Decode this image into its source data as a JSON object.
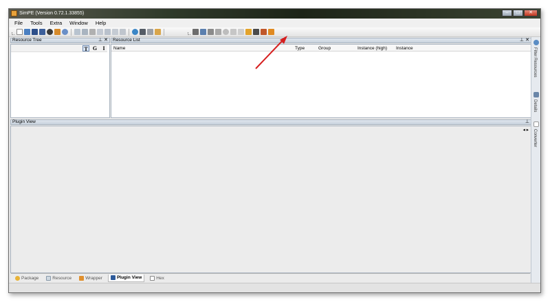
{
  "window": {
    "title": "SimPE (Version 0.72.1.33855)",
    "controls": {
      "minimize": "–",
      "maximize": "□",
      "close": "✕"
    }
  },
  "menu": [
    "File",
    "Tools",
    "Extra",
    "Window",
    "Help"
  ],
  "toolbar": {
    "groups": [
      {
        "icons": [
          "new-file-icon",
          "open-file-icon",
          "save-icon",
          "save-as-icon",
          "globe-icon",
          "tools-icon",
          "gear-icon"
        ]
      },
      {
        "icons": [
          "copy-icon",
          "paste-icon",
          "cut-icon",
          "find-icon",
          "find-next-icon",
          "list-icon",
          "grid-icon"
        ]
      },
      {
        "icons": [
          "refresh-icon",
          "user-icon",
          "wrench-icon",
          "tag-icon"
        ]
      },
      {
        "icons": [
          "package-icon",
          "open-package-icon",
          "folder-icon",
          "merge-icon",
          "gear-small-icon",
          "list-small-icon",
          "cross-icon",
          "lock-icon",
          "camera-icon",
          "scissors-icon",
          "fire-icon"
        ]
      }
    ],
    "highlight_arrow_color": "#d61f1f"
  },
  "resource_tree": {
    "title": "Resource Tree",
    "pin": "⊥",
    "close": "✕",
    "view_buttons": [
      "T",
      "G",
      "I"
    ],
    "active_view": "T"
  },
  "resource_list": {
    "title": "Resource List",
    "pin": "⊥",
    "close": "✕",
    "columns": [
      "Name",
      "Type",
      "Group",
      "Instance (high)",
      "Instance"
    ],
    "rows": []
  },
  "plugin_view": {
    "title": "Plugin View",
    "pin": "⊥",
    "nav": "◂ ▸"
  },
  "side_tabs": [
    {
      "label": "Filter Resources",
      "icon": "magnifier-icon"
    },
    {
      "label": "Details",
      "icon": "details-icon"
    },
    {
      "label": "Converter",
      "icon": "converter-icon"
    }
  ],
  "bottom_tabs": [
    {
      "label": "Package",
      "icon": "package-tab-icon",
      "active": false
    },
    {
      "label": "Resource",
      "icon": "resource-tab-icon",
      "active": false
    },
    {
      "label": "Wrapper",
      "icon": "wrapper-tab-icon",
      "active": false
    },
    {
      "label": "Plugin View",
      "icon": "plugin-tab-icon",
      "active": true
    },
    {
      "label": "Hex",
      "icon": "hex-tab-icon",
      "active": false
    }
  ]
}
